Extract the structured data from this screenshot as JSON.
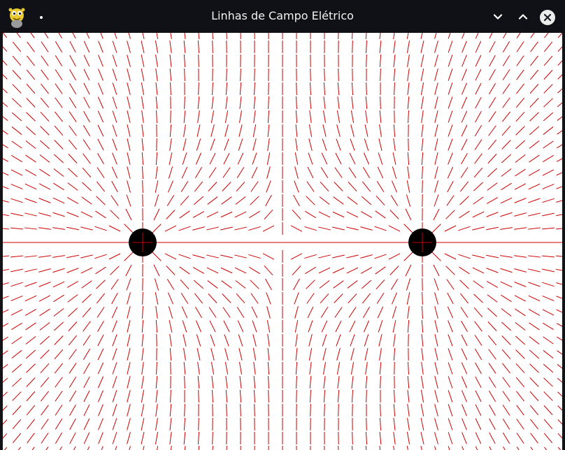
{
  "window": {
    "title": "Linhas de Campo Elétrico",
    "app_icon": "python-snake-icon",
    "menu_dot": "•",
    "buttons": {
      "minimize_icon": "chevron-down-icon",
      "maximize_icon": "chevron-up-icon",
      "close_icon": "close-icon"
    }
  },
  "colors": {
    "field_line": "#cc0000",
    "charge": "#000000",
    "background": "#ffffff",
    "titlebar": "#0f1116"
  },
  "simulation": {
    "charges": [
      {
        "name": "charge-left",
        "sign": "+"
      },
      {
        "name": "charge-right",
        "sign": "+"
      }
    ]
  }
}
